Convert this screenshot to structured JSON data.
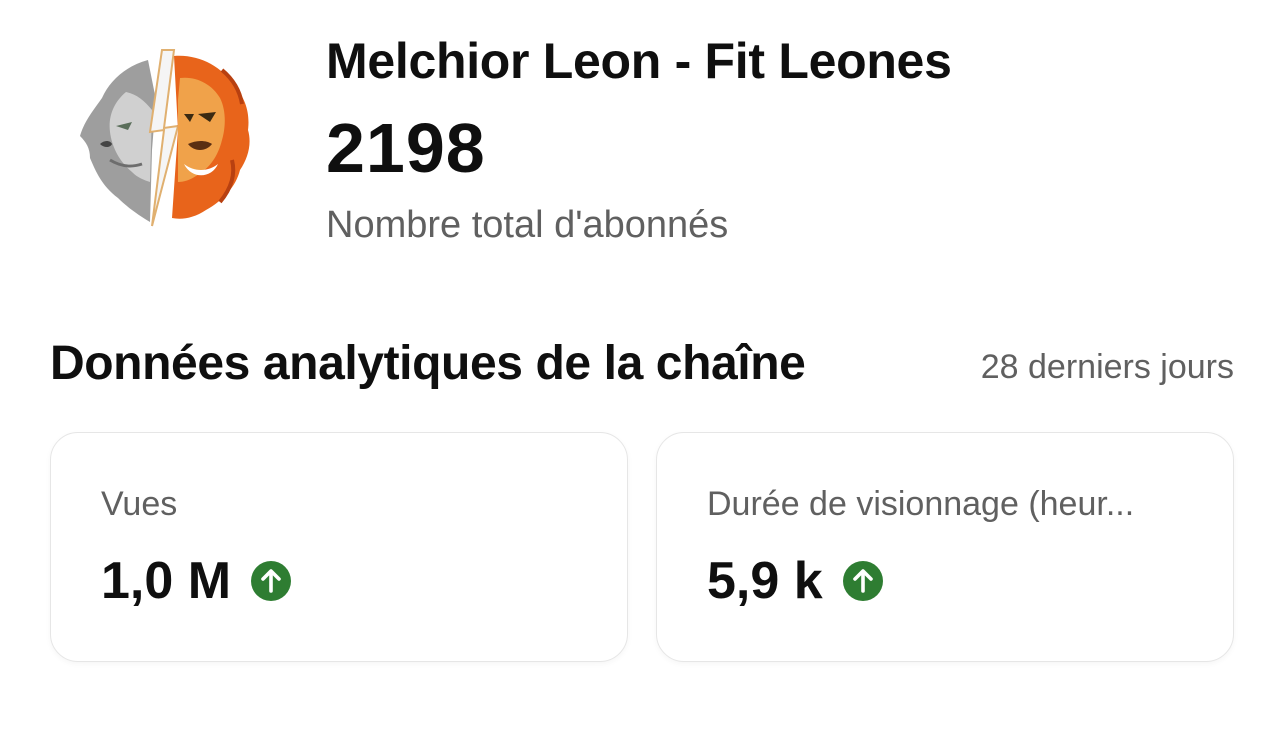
{
  "channel": {
    "name": "Melchior Leon - Fit Leones",
    "subscriber_count": "2198",
    "subscriber_label": "Nombre total d'abonnés",
    "avatar_icon": "lion-logo-avatar"
  },
  "analytics": {
    "title": "Données analytiques de la chaîne",
    "period": "28 derniers jours",
    "cards": [
      {
        "label": "Vues",
        "value": "1,0 M",
        "trend": "up",
        "trend_icon": "arrow-up-circle-icon",
        "trend_color": "#2e7d32"
      },
      {
        "label": "Durée de visionnage (heur...",
        "value": "5,9 k",
        "trend": "up",
        "trend_icon": "arrow-up-circle-icon",
        "trend_color": "#2e7d32"
      }
    ]
  }
}
